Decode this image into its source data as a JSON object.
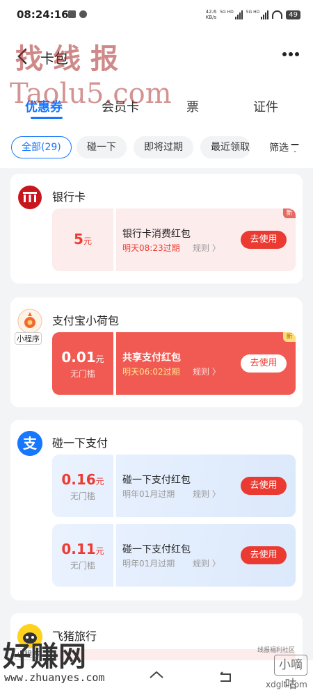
{
  "status_bar": {
    "time": "08:24:16",
    "net_speed_value": "42.6",
    "net_speed_unit": "KB/s",
    "sim1_label": "5G HD",
    "sim2_label": "5G HD",
    "battery": "49"
  },
  "header": {
    "title": "卡包",
    "back_icon": "chevron-left-icon",
    "more_icon": "more-dots-icon"
  },
  "tabs": [
    {
      "label": "优惠券",
      "active": true
    },
    {
      "label": "会员卡",
      "active": false
    },
    {
      "label": "票",
      "active": false
    },
    {
      "label": "证件",
      "active": false
    }
  ],
  "filters": {
    "chips": [
      {
        "label": "全部(29)",
        "active": true
      },
      {
        "label": "碰一下",
        "active": false
      },
      {
        "label": "即将过期",
        "active": false
      },
      {
        "label": "最近领取",
        "active": false
      }
    ],
    "filter_label": "筛选"
  },
  "merchants": [
    {
      "name": "银行卡",
      "logo_icon": "bank-icon",
      "coupons": [
        {
          "amount": "5",
          "unit": "元",
          "sub": "",
          "title": "银行卡消费红包",
          "expiry": "明天08:23过期",
          "rule": "规则 〉",
          "button": "去使用",
          "badge": "新",
          "style": "bank"
        }
      ]
    },
    {
      "name": "支付宝小荷包",
      "logo_icon": "lotus-icon",
      "tag": "小程序",
      "coupons": [
        {
          "amount": "0.01",
          "unit": "元",
          "sub": "无门槛",
          "title": "共享支付红包",
          "expiry": "明天06:02过期",
          "rule": "规则 〉",
          "button": "去使用",
          "badge": "新",
          "style": "red"
        }
      ]
    },
    {
      "name": "碰一下支付",
      "logo_icon": "alipay-icon",
      "coupons": [
        {
          "amount": "0.16",
          "unit": "元",
          "sub": "无门槛",
          "title": "碰一下支付红包",
          "expiry": "明年01月过期",
          "rule": "规则 〉",
          "button": "去使用",
          "style": "blue"
        },
        {
          "amount": "0.11",
          "unit": "元",
          "sub": "无门槛",
          "title": "碰一下支付红包",
          "expiry": "明年01月过期",
          "rule": "规则 〉",
          "button": "去使用",
          "style": "blue"
        }
      ]
    },
    {
      "name": "飞猪旅行",
      "logo_icon": "fliggy-icon",
      "tag": "小程序"
    }
  ],
  "watermarks": {
    "top_cn": "找线报",
    "top_en": "Taolu5.com",
    "bottom_cn": "好赚网",
    "bottom_url": "www.zhuanyes.com",
    "right_cn": "小嘀咕",
    "right_sub": "线报福利社区",
    "right_url": "xdglt.com"
  },
  "colors": {
    "accent_blue": "#1677ff",
    "coupon_red": "#ee3b32",
    "coupon_red_bg": "#f05a52"
  }
}
